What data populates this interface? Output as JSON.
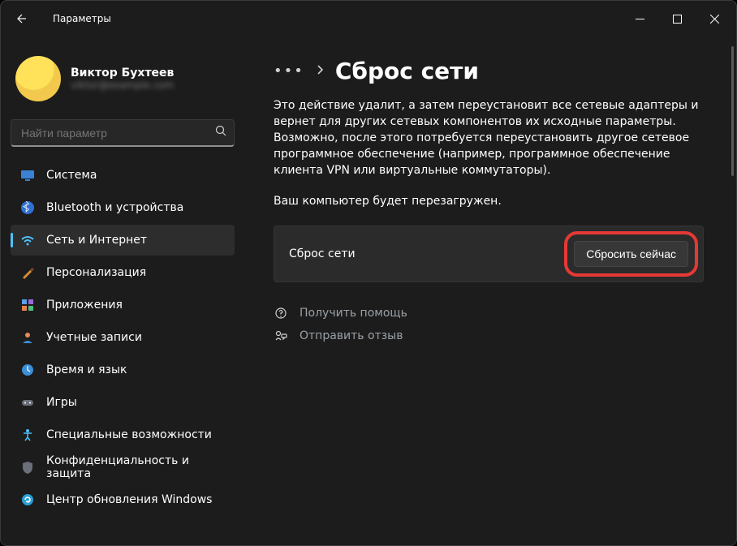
{
  "window": {
    "title": "Параметры"
  },
  "profile": {
    "name": "Виктор Бухтеев",
    "email": "viktor@example.com"
  },
  "search": {
    "placeholder": "Найти параметр"
  },
  "sidebar": {
    "items": [
      {
        "label": "Система"
      },
      {
        "label": "Bluetooth и устройства"
      },
      {
        "label": "Сеть и Интернет"
      },
      {
        "label": "Персонализация"
      },
      {
        "label": "Приложения"
      },
      {
        "label": "Учетные записи"
      },
      {
        "label": "Время и язык"
      },
      {
        "label": "Игры"
      },
      {
        "label": "Специальные возможности"
      },
      {
        "label": "Конфиденциальность и защита"
      },
      {
        "label": "Центр обновления Windows"
      }
    ]
  },
  "main": {
    "breadcrumb_more": "•••",
    "page_title": "Сброс сети",
    "description": "Это действие удалит, а затем переустановит все сетевые адаптеры и вернет для других сетевых компонентов их исходные параметры. Возможно, после этого потребуется переустановить другое сетевое программное обеспечение (например, программное обеспечение клиента VPN или виртуальные коммутаторы).",
    "subnote": "Ваш компьютер будет перезагружен.",
    "card_label": "Сброс сети",
    "reset_button": "Сбросить сейчас",
    "help_link": "Получить помощь",
    "feedback_link": "Отправить отзыв"
  }
}
